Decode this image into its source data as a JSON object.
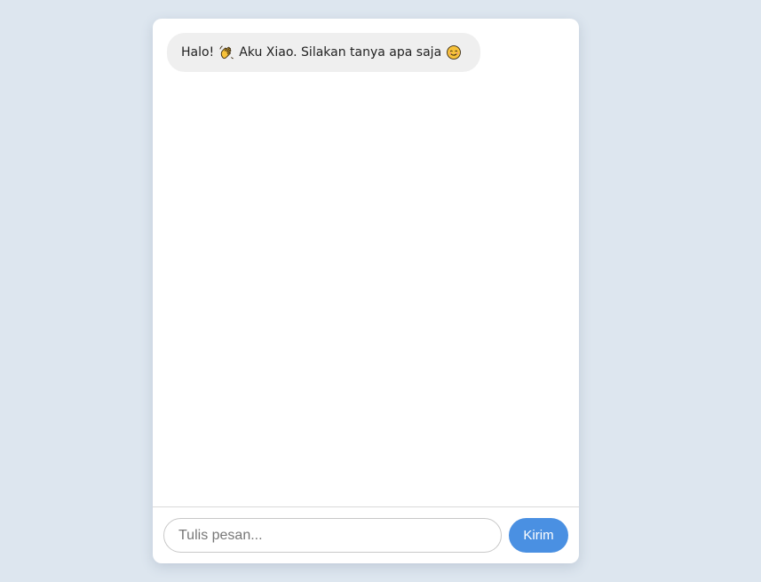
{
  "chat": {
    "messages": [
      {
        "sender": "bot",
        "text_before": "Halo!",
        "emoji_1": "waving-hand-icon",
        "text_middle": "Aku Xiao. Silakan tanya apa saja",
        "emoji_2": "smiling-face-icon"
      }
    ]
  },
  "composer": {
    "placeholder": "Tulis pesan...",
    "value": "",
    "send_label": "Kirim"
  },
  "colors": {
    "page_background": "#dde6ef",
    "card_background": "#ffffff",
    "bubble_background": "#efefef",
    "accent": "#4a90e2"
  }
}
